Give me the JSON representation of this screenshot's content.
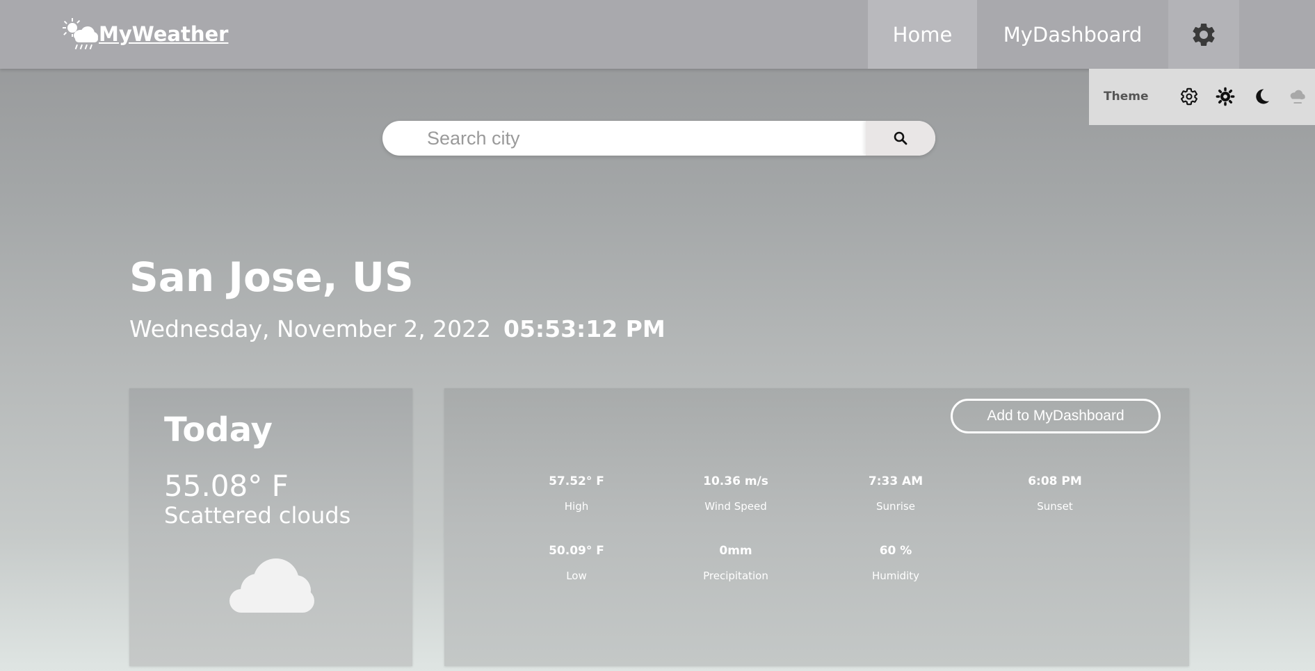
{
  "header": {
    "logo_text": "MyWeather",
    "nav": {
      "home": "Home",
      "dashboard": "MyDashboard"
    }
  },
  "theme_menu": {
    "label": "Theme",
    "options": [
      "auto-theme-icon",
      "light-theme-icon",
      "dark-theme-icon",
      "cloudy-theme-icon"
    ]
  },
  "search": {
    "placeholder": "Search city",
    "value": ""
  },
  "location": {
    "city": "San Jose, US",
    "date": "Wednesday, November 2, 2022",
    "time": "05:53:12 PM"
  },
  "today": {
    "title": "Today",
    "temperature": "55.08° F",
    "description": "Scattered clouds",
    "icon": "cloud-icon"
  },
  "details": {
    "add_button": "Add to MyDashboard",
    "stats": [
      {
        "value": "57.52° F",
        "label": "High"
      },
      {
        "value": "10.36 m/s",
        "label": "Wind Speed"
      },
      {
        "value": "7:33 AM",
        "label": "Sunrise"
      },
      {
        "value": "6:08 PM",
        "label": "Sunset"
      },
      {
        "value": "50.09° F",
        "label": "Low"
      },
      {
        "value": "0mm",
        "label": "Precipitation"
      },
      {
        "value": "60 %",
        "label": "Humidity"
      }
    ]
  },
  "colors": {
    "header_bg": "#a9a9ad",
    "nav_active_bg": "#b9b9bd",
    "theme_popup_bg": "#dcdcdc",
    "text": "#ffffff"
  }
}
